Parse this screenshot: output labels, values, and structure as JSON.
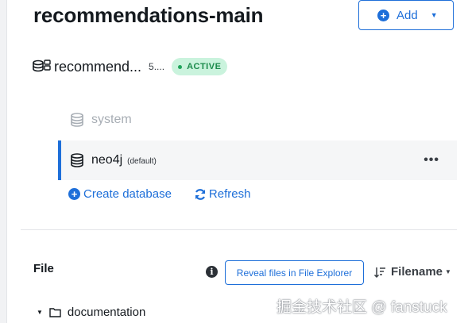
{
  "page": {
    "title": "recommendations-main",
    "add_button": {
      "label": "Add"
    }
  },
  "dbms": {
    "name": "recommend...",
    "version": "5....",
    "status": "ACTIVE"
  },
  "databases": [
    {
      "name": "system"
    },
    {
      "name": "neo4j",
      "tag": "(default)",
      "more": "•••"
    }
  ],
  "actions": {
    "create": "Create database",
    "refresh": "Refresh"
  },
  "files": {
    "label": "File",
    "info": "i",
    "reveal_button": "Reveal files in File Explorer",
    "sort_label": "Filename",
    "tree": [
      {
        "name": "documentation"
      }
    ]
  },
  "watermark": "掘金技术社区 @ fanstuck",
  "colors": {
    "accent": "#1e6fd9",
    "active_badge_bg": "#caf3dd",
    "active_badge_text": "#1a8a4a"
  }
}
